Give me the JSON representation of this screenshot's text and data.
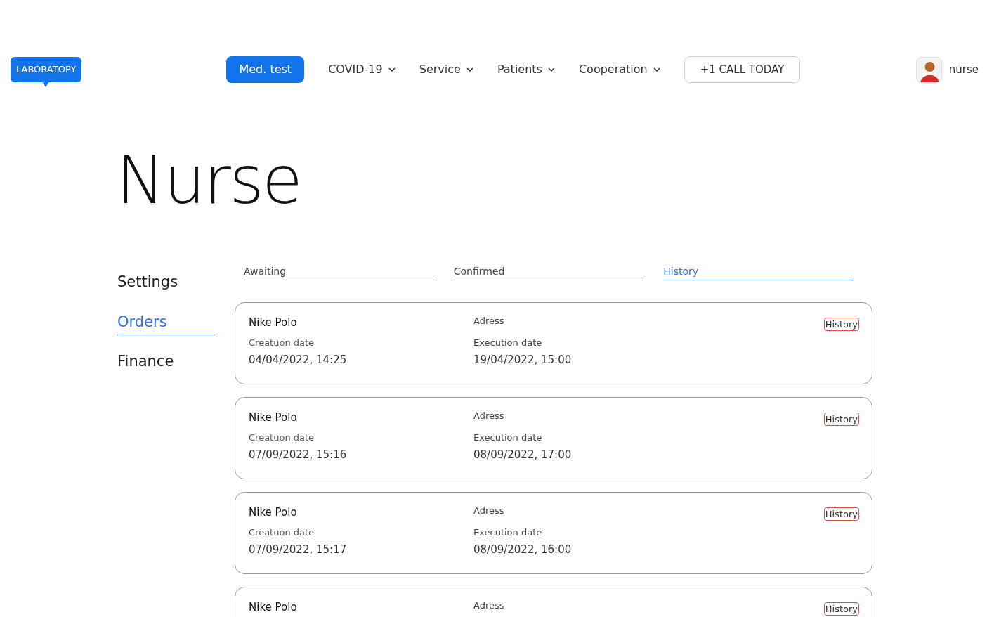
{
  "logo": "LABORATOPY",
  "nav": [
    {
      "label": "Med. test",
      "kind": "button"
    },
    {
      "label": "COVID-19",
      "kind": "dropdown"
    },
    {
      "label": "Service",
      "kind": "dropdown"
    },
    {
      "label": "Patients",
      "kind": "dropdown"
    },
    {
      "label": "Cooperation",
      "kind": "dropdown"
    },
    {
      "label": "+1 CALL TODAY",
      "kind": "outline"
    }
  ],
  "user": {
    "name": "nurse"
  },
  "title": "Nurse",
  "sidebar": [
    {
      "label": "Settings",
      "selected": false
    },
    {
      "label": "Orders",
      "selected": true
    },
    {
      "label": "Finance",
      "selected": false
    }
  ],
  "tabs": [
    {
      "label": "Awaiting",
      "selected": false
    },
    {
      "label": "Confirmed",
      "selected": false
    },
    {
      "label": "History",
      "selected": true
    }
  ],
  "orders": [
    {
      "name": "Nike Polo",
      "address_label": "Adress",
      "badge": "History",
      "creation_label": "Creatuon date",
      "creation": "04/04/2022, 14:25",
      "execution_label": "Execution date",
      "execution": "19/04/2022, 15:00"
    },
    {
      "name": "Nike Polo",
      "address_label": "Adress",
      "badge": "History",
      "creation_label": "Creatuon date",
      "creation": "07/09/2022, 15:16",
      "execution_label": "Execution date",
      "execution": "08/09/2022, 17:00"
    },
    {
      "name": "Nike Polo",
      "address_label": "Adress",
      "badge": "History",
      "creation_label": "Creatuon date",
      "creation": "07/09/2022, 15:17",
      "execution_label": "Execution date",
      "execution": "08/09/2022, 16:00"
    },
    {
      "name": "Nike Polo",
      "address_label": "Adress",
      "badge": "History"
    }
  ]
}
